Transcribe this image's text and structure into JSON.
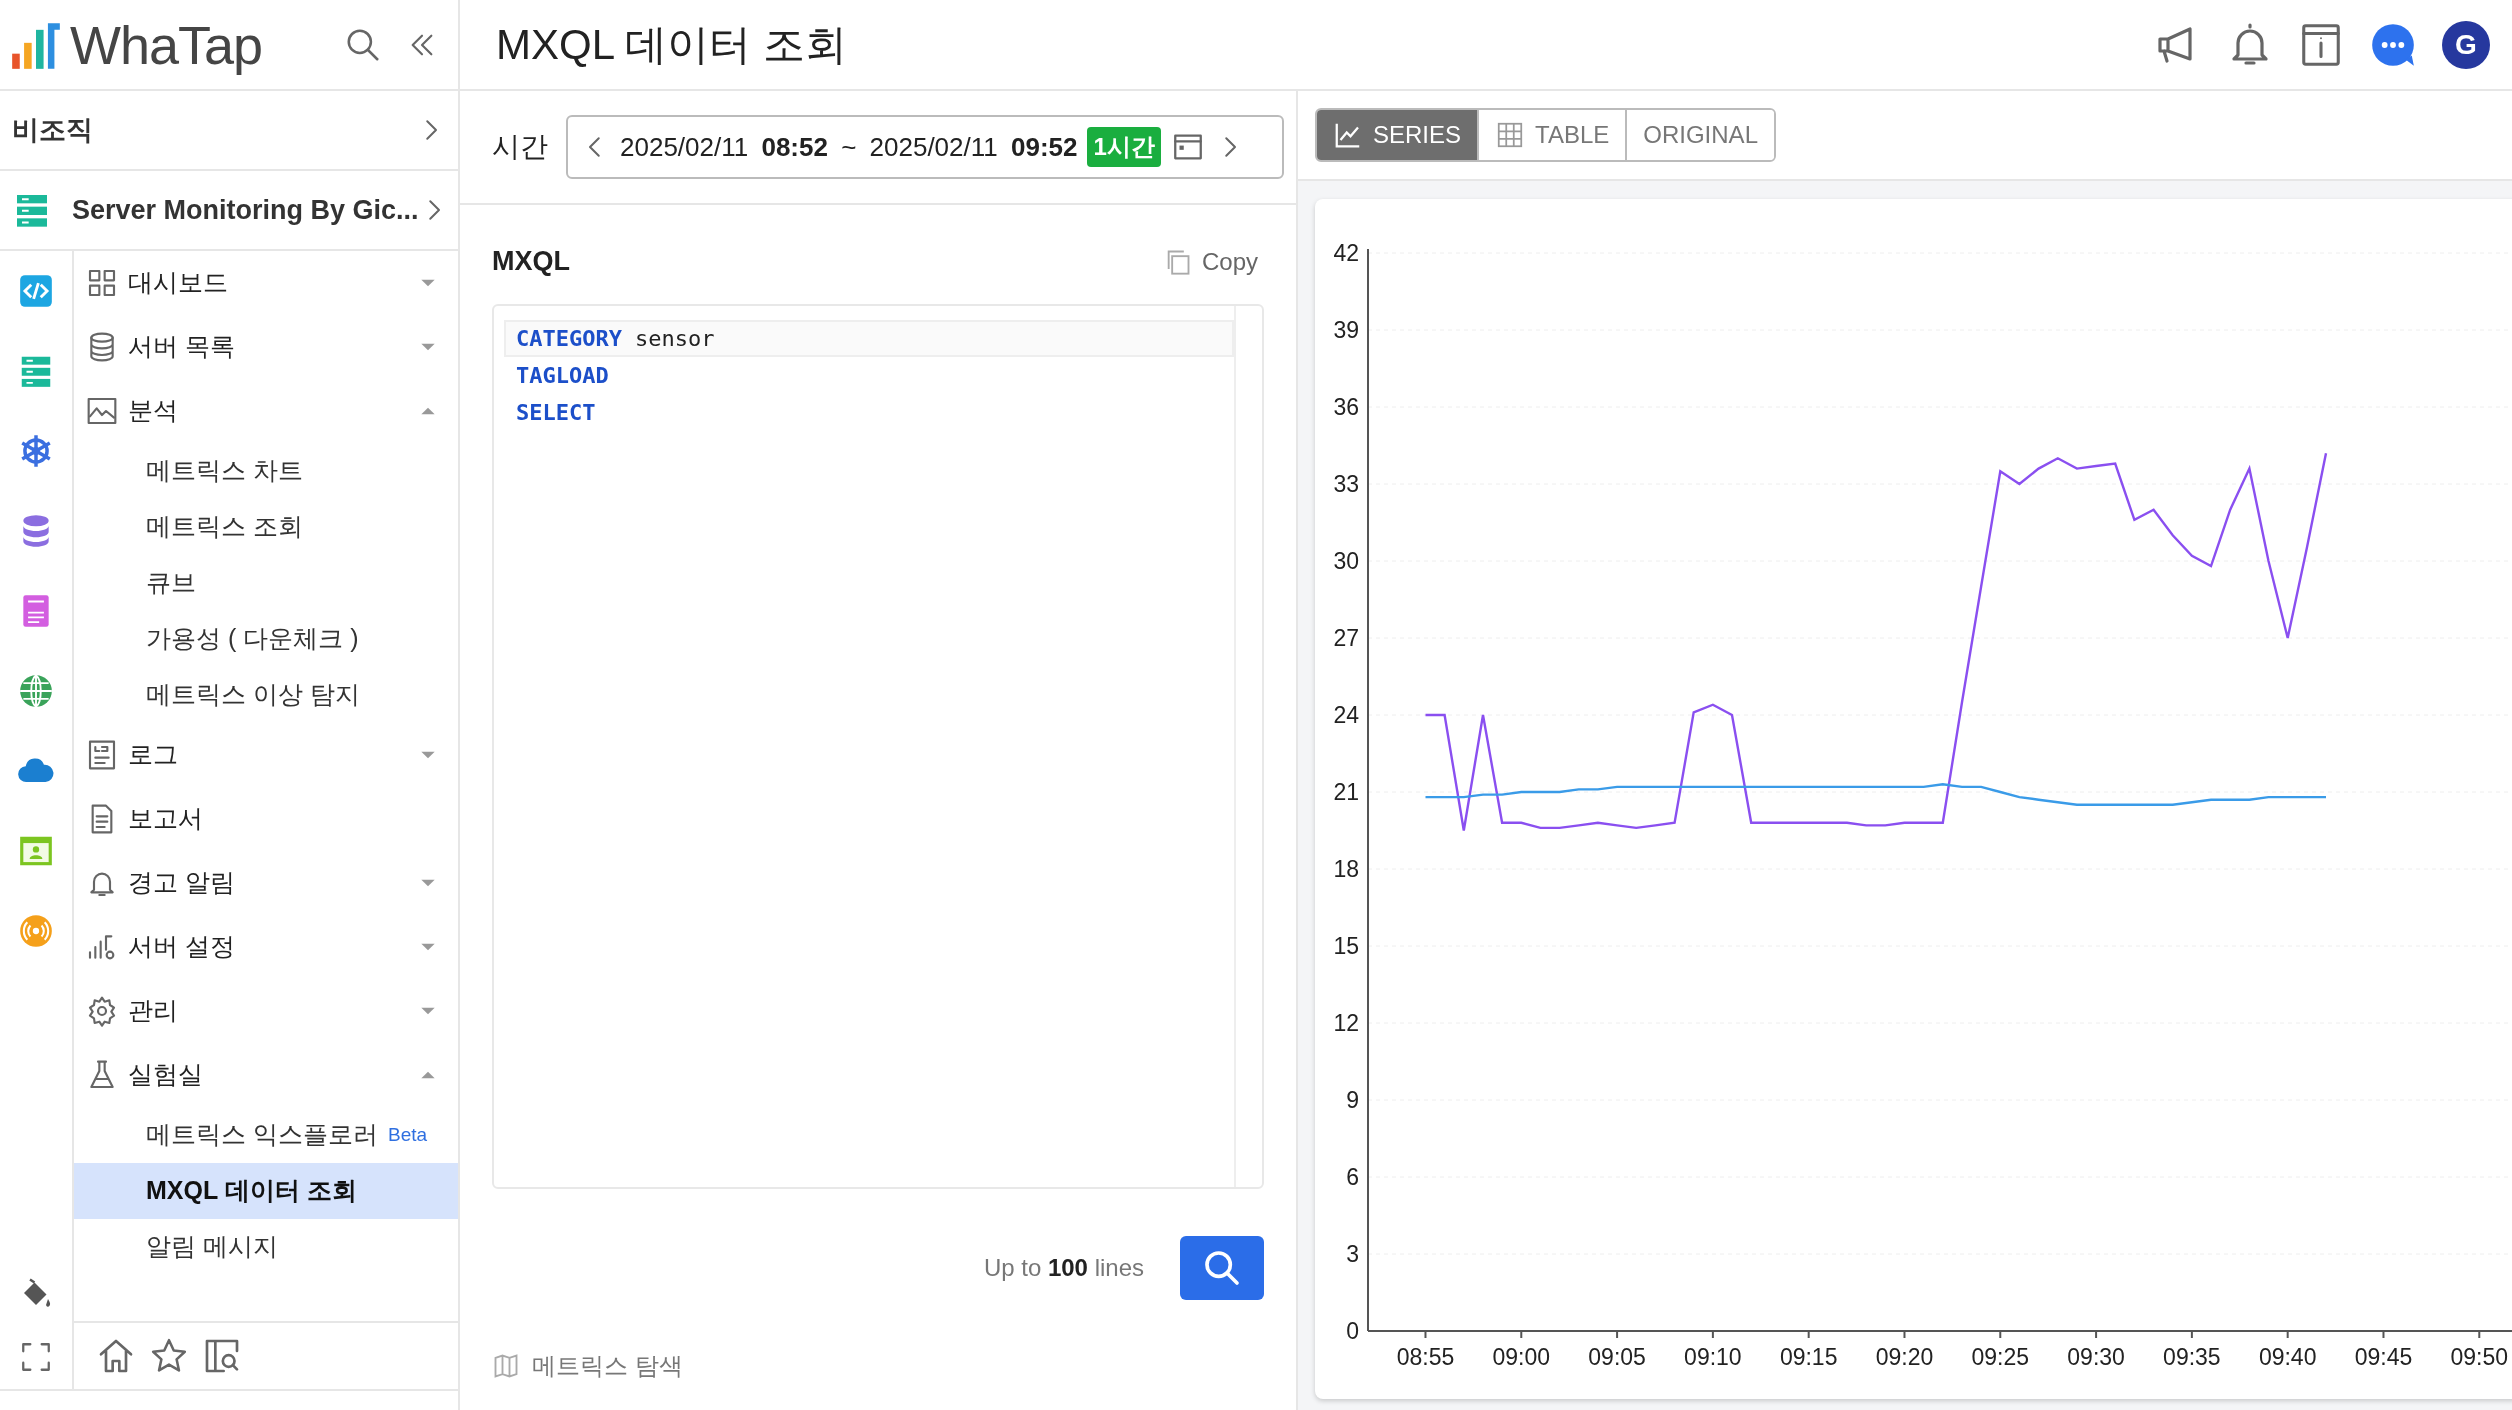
{
  "sidebar": {
    "logo": "WhaTap",
    "org": "비조직",
    "project": "Server Monitoring By Gic...",
    "menu": [
      {
        "label": "대시보드",
        "kind": "group",
        "expanded": false
      },
      {
        "label": "서버 목록",
        "kind": "group",
        "expanded": false
      },
      {
        "label": "분석",
        "kind": "group",
        "expanded": true,
        "children": [
          {
            "label": "메트릭스 차트",
            "selected": false
          },
          {
            "label": "메트릭스 조회",
            "selected": false
          },
          {
            "label": "큐브",
            "selected": false
          },
          {
            "label": "가용성 ( 다운체크 )",
            "selected": false
          },
          {
            "label": "메트릭스 이상 탐지",
            "selected": false
          }
        ]
      },
      {
        "label": "로그",
        "kind": "group",
        "expanded": false
      },
      {
        "label": "보고서",
        "kind": "link"
      },
      {
        "label": "경고 알림",
        "kind": "group",
        "expanded": false
      },
      {
        "label": "서버 설정",
        "kind": "group",
        "expanded": false
      },
      {
        "label": "관리",
        "kind": "group",
        "expanded": false
      },
      {
        "label": "실험실",
        "kind": "group",
        "expanded": true,
        "children": [
          {
            "label": "메트릭스 익스플로러",
            "badge": "Beta",
            "selected": false
          },
          {
            "label": "MXQL 데이터 조회",
            "selected": true
          },
          {
            "label": "알림 메시지",
            "selected": false
          }
        ]
      }
    ]
  },
  "header": {
    "title": "MXQL 데이터 조회",
    "avatar": "G"
  },
  "time": {
    "label": "시간",
    "range": "2025/02/11 **08:52** ~ 2025/02/11 **09:52**",
    "badge": "1시간"
  },
  "query": {
    "title": "MXQL",
    "copy": "Copy",
    "lines": [
      {
        "keyword": "CATEGORY",
        "argument": "sensor",
        "current": true
      },
      {
        "keyword": "TAGLOAD",
        "current": false
      },
      {
        "keyword": "SELECT",
        "current": false
      }
    ],
    "limit": "Up to **100** lines",
    "explore": "메트릭스 탐색"
  },
  "view_tabs": [
    {
      "label": "SERIES",
      "selected": true
    },
    {
      "label": "TABLE",
      "selected": false
    },
    {
      "label": "ORIGINAL",
      "selected": false
    }
  ],
  "chart_data": {
    "type": "line",
    "grid": true,
    "ylim": [
      0,
      42
    ],
    "categories": [
      null,
      null,
      "08:55",
      null,
      null,
      null,
      null,
      "09:00",
      null,
      null,
      null,
      null,
      "09:05",
      null,
      null,
      null,
      null,
      "09:10",
      null,
      null,
      null,
      null,
      "09:15",
      null,
      null,
      null,
      null,
      "09:20",
      null,
      null,
      null,
      null,
      "09:25",
      null,
      null,
      null,
      null,
      "09:30",
      null,
      null,
      null,
      null,
      "09:35",
      null,
      null,
      null,
      null,
      "09:40",
      null,
      null,
      null,
      null,
      "09:45",
      null,
      null,
      null,
      null,
      "09:50",
      null
    ],
    "yticks": [
      0,
      3,
      6,
      9,
      12,
      15,
      18,
      21,
      24,
      27,
      30,
      33,
      36,
      39,
      42
    ],
    "series": [
      {
        "color": "#8a4ff0",
        "values": [
          null,
          null,
          24,
          24,
          19.5,
          24,
          19.8,
          19.8,
          19.6,
          19.6,
          19.7,
          19.8,
          19.7,
          19.6,
          19.7,
          19.8,
          24.1,
          24.4,
          24,
          19.8,
          19.8,
          19.8,
          19.8,
          19.8,
          19.8,
          19.7,
          19.7,
          19.8,
          19.8,
          19.8,
          24.5,
          29,
          33.5,
          33,
          33.6,
          34,
          33.6,
          33.7,
          33.8,
          31.6,
          32,
          31,
          30.2,
          29.8,
          32,
          33.6,
          30,
          27,
          30.5,
          34.2,
          null,
          null,
          null,
          null,
          null,
          null,
          null,
          null,
          null
        ]
      },
      {
        "color": "#3a9be8",
        "values": [
          null,
          null,
          20.8,
          20.8,
          20.8,
          20.9,
          20.9,
          21,
          21,
          21,
          21.1,
          21.1,
          21.2,
          21.2,
          21.2,
          21.2,
          21.2,
          21.2,
          21.2,
          21.2,
          21.2,
          21.2,
          21.2,
          21.2,
          21.2,
          21.2,
          21.2,
          21.2,
          21.2,
          21.3,
          21.2,
          21.2,
          21,
          20.8,
          20.7,
          20.6,
          20.5,
          20.5,
          20.5,
          20.5,
          20.5,
          20.5,
          20.6,
          20.7,
          20.7,
          20.7,
          20.8,
          20.8,
          20.8,
          20.8,
          null,
          null,
          null,
          null,
          null,
          null,
          null,
          null,
          null
        ]
      }
    ]
  }
}
